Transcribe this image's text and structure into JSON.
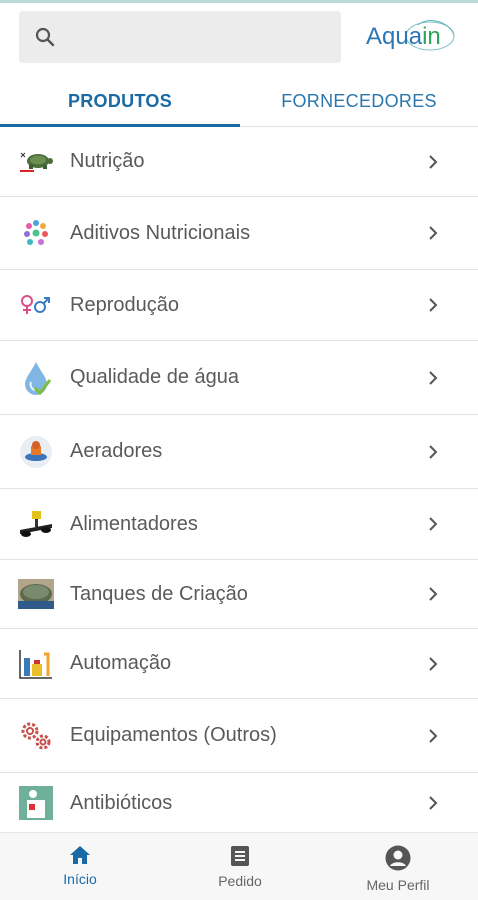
{
  "search": {
    "placeholder": "",
    "icon": "search-icon"
  },
  "logo": {
    "part1": "Aqua",
    "part2": "in"
  },
  "tabs": [
    {
      "label": "PRODUTOS",
      "active": true
    },
    {
      "label": "FORNECEDORES",
      "active": false
    }
  ],
  "categories": [
    {
      "label": "Nutrição",
      "icon": "turtle-icon"
    },
    {
      "label": "Aditivos Nutricionais",
      "icon": "molecules-icon"
    },
    {
      "label": "Reprodução",
      "icon": "gender-symbols-icon"
    },
    {
      "label": "Qualidade de água",
      "icon": "water-drop-icon"
    },
    {
      "label": "Aeradores",
      "icon": "aerator-icon"
    },
    {
      "label": "Alimentadores",
      "icon": "feeder-icon"
    },
    {
      "label": "Tanques de Criação",
      "icon": "tank-icon"
    },
    {
      "label": "Automação",
      "icon": "automation-icon"
    },
    {
      "label": "Equipamentos (Outros)",
      "icon": "gears-icon"
    },
    {
      "label": "Antibióticos",
      "icon": "medicine-icon"
    }
  ],
  "bottom_nav": [
    {
      "label": "Início",
      "icon": "home-icon",
      "active": true
    },
    {
      "label": "Pedido",
      "icon": "order-icon",
      "active": false
    },
    {
      "label": "Meu Perfil",
      "icon": "profile-icon",
      "active": false
    }
  ],
  "colors": {
    "accent": "#1a6aa6",
    "logo_blue": "#2b76b5",
    "logo_green": "#2aa35a"
  }
}
